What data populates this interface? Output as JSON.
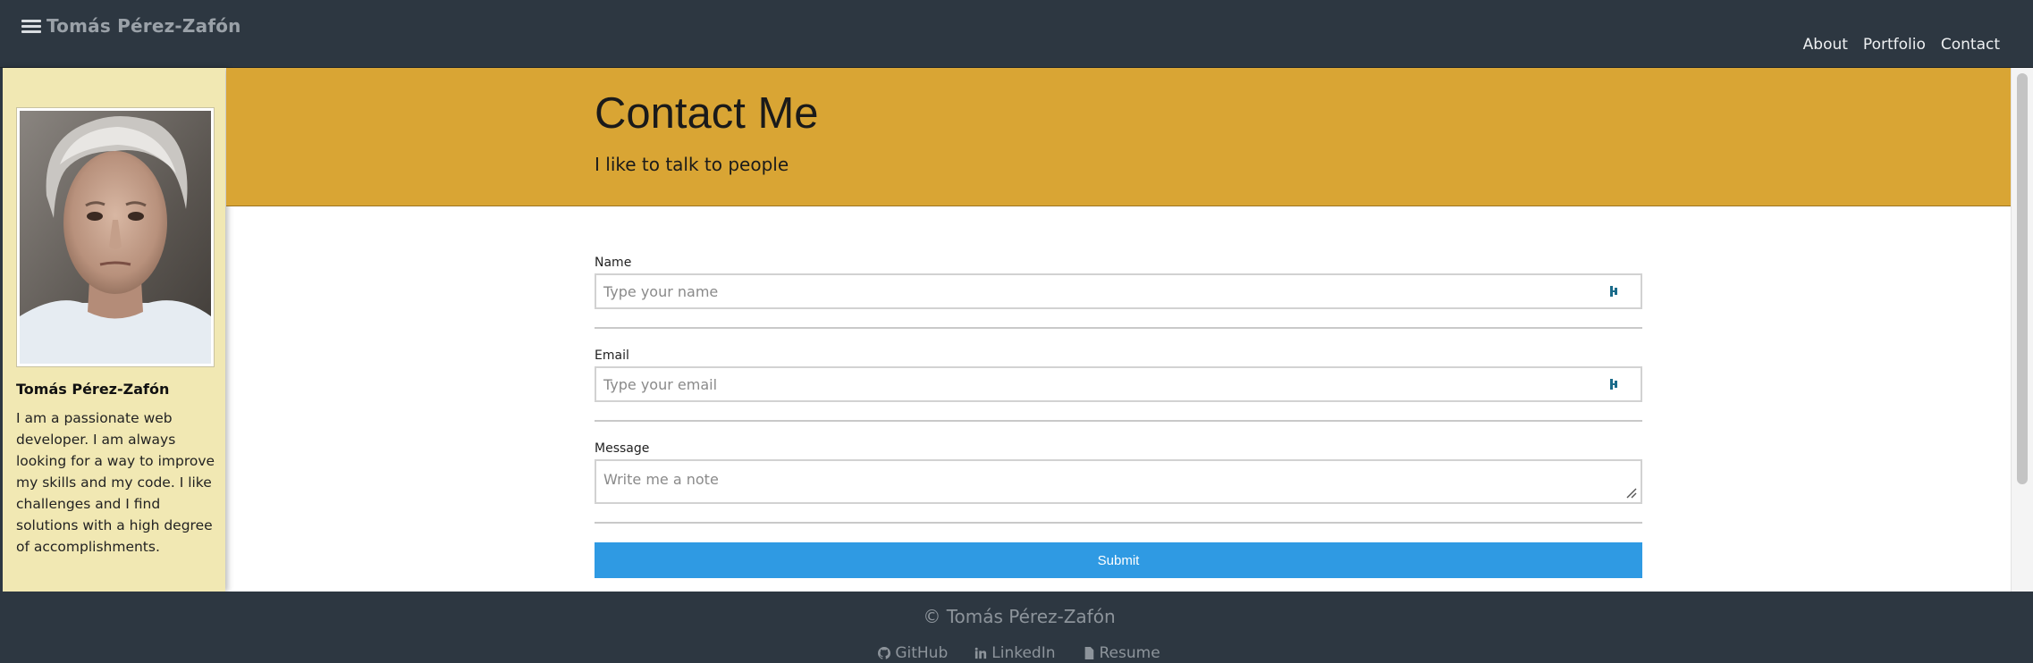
{
  "navbar": {
    "brand": "Tomás Pérez-Zafón",
    "links": [
      "About",
      "Portfolio",
      "Contact"
    ]
  },
  "sidebar": {
    "name": "Tomás Pérez-Zafón",
    "bio": "I am a passionate web developer. I am always looking for a way to improve my skills and my code. I like challenges and I find solutions with a high degree of accomplishments."
  },
  "hero": {
    "title": "Contact Me",
    "subtitle": "I like to talk to people"
  },
  "form": {
    "name_label": "Name",
    "name_placeholder": "Type your name",
    "email_label": "Email",
    "email_placeholder": "Type your email",
    "message_label": "Message",
    "message_placeholder": "Write me a note",
    "submit_label": "Submit"
  },
  "footer": {
    "copyright": "© Tomás Pérez-Zafón",
    "links": [
      "GitHub",
      "LinkedIn",
      "Resume"
    ]
  },
  "colors": {
    "navbar": "#2d3741",
    "sidebar": "#f1e8b3",
    "hero": "#d9a534",
    "submit": "#2f9ae3"
  }
}
